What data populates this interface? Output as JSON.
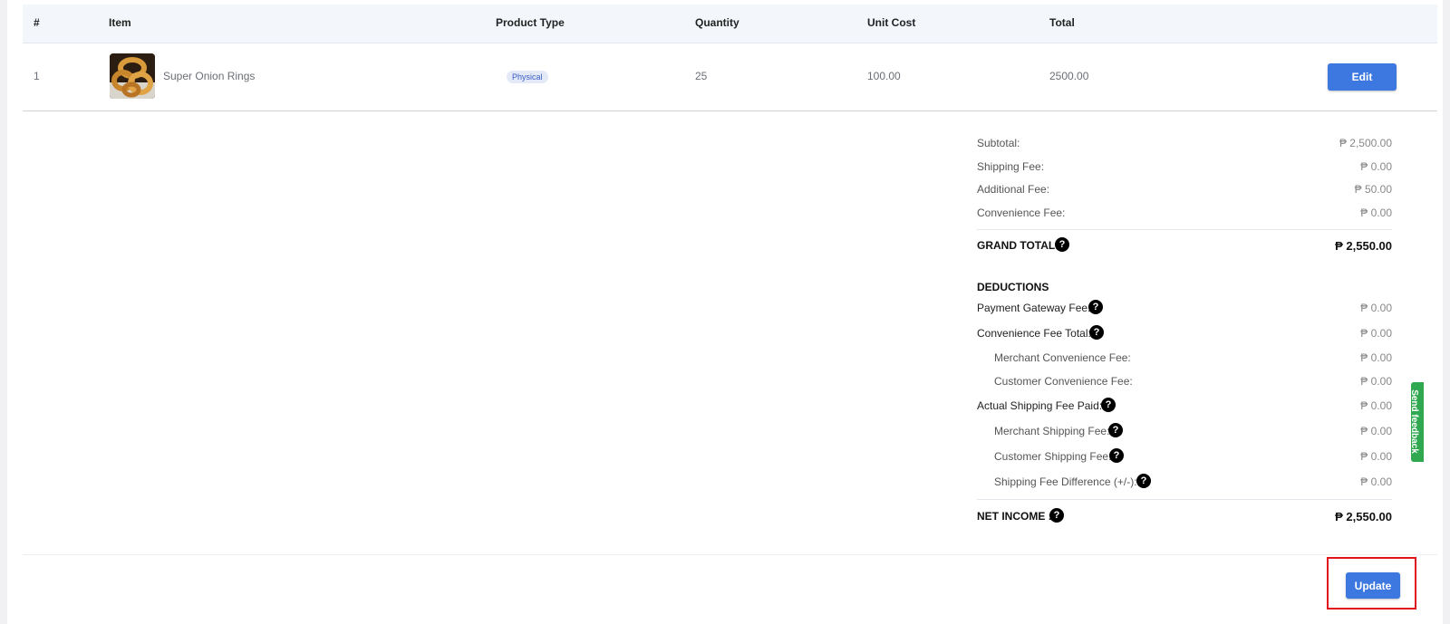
{
  "table": {
    "headers": {
      "num": "#",
      "item": "Item",
      "product_type": "Product Type",
      "quantity": "Quantity",
      "unit_cost": "Unit Cost",
      "total": "Total"
    },
    "rows": [
      {
        "num": "1",
        "item": "Super Onion Rings",
        "product_type": "Physical",
        "quantity": "25",
        "unit_cost": "100.00",
        "total": "2500.00",
        "edit_label": "Edit"
      }
    ]
  },
  "summary": {
    "subtotal": {
      "label": "Subtotal:",
      "value": "₱ 2,500.00"
    },
    "shipping_fee": {
      "label": "Shipping Fee:",
      "value": "₱ 0.00"
    },
    "additional_fee": {
      "label": "Additional Fee:",
      "value": "₱ 50.00"
    },
    "convenience_fee": {
      "label": "Convenience Fee:",
      "value": "₱ 0.00"
    },
    "grand_total": {
      "label": "GRAND TOTAL:",
      "value": "₱ 2,550.00"
    },
    "deductions_heading": "DEDUCTIONS",
    "payment_gateway_fee": {
      "label": "Payment Gateway Fee:",
      "value": "₱ 0.00"
    },
    "convenience_fee_total": {
      "label": "Convenience Fee Total:",
      "value": "₱ 0.00"
    },
    "merchant_convenience_fee": {
      "label": "Merchant Convenience Fee:",
      "value": "₱ 0.00"
    },
    "customer_convenience_fee": {
      "label": "Customer Convenience Fee:",
      "value": "₱ 0.00"
    },
    "actual_shipping_fee_paid": {
      "label": "Actual Shipping Fee Paid:",
      "value": "₱ 0.00"
    },
    "merchant_shipping_fee": {
      "label": "Merchant Shipping Fee:",
      "value": "₱ 0.00"
    },
    "customer_shipping_fee": {
      "label": "Customer Shipping Fee:",
      "value": "₱ 0.00"
    },
    "shipping_fee_difference": {
      "label": "Shipping Fee Difference (+/-):",
      "value": "₱ 0.00"
    },
    "net_income": {
      "label": "NET INCOME :",
      "value": "₱ 2,550.00"
    }
  },
  "help_icon_glyph": "?",
  "actions": {
    "update_label": "Update"
  },
  "feedback": {
    "label": "Send feedback"
  },
  "colors": {
    "primary_button": "#3d77e0",
    "highlight_border": "#e0141a",
    "feedback_tab": "#2fa84f"
  }
}
